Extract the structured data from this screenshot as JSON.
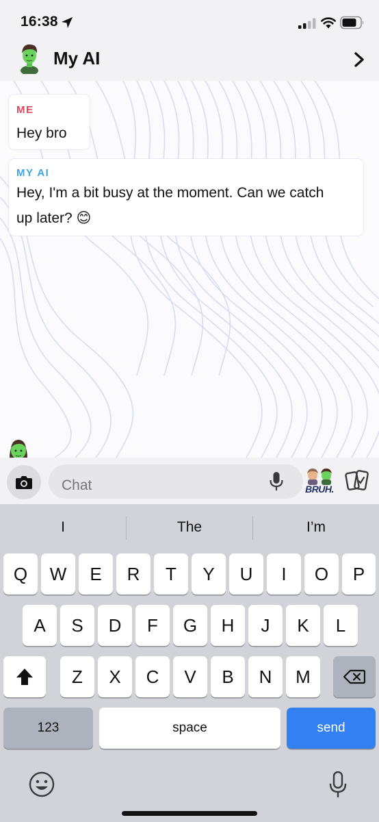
{
  "status_bar": {
    "time": "16:38",
    "icons": [
      "location-arrow-icon",
      "cellular-signal-icon",
      "wifi-icon",
      "battery-icon"
    ]
  },
  "header": {
    "title": "My AI",
    "avatar_icon": "bitmoji-avatar-icon",
    "right_icon": "chevron-right-icon"
  },
  "messages": [
    {
      "sender": "ME",
      "text": "Hey bro",
      "sender_color": "#e0475d"
    },
    {
      "sender": "MY AI",
      "lines": [
        "Hey, I'm a bit busy at the moment. Can we catch",
        "up later? 😊"
      ],
      "sender_color": "#3fa3e6"
    }
  ],
  "input_bar": {
    "placeholder": "Chat",
    "bitmoji_label": "BRUH.",
    "icons": [
      "camera-icon",
      "microphone-icon",
      "bitmoji-sticker-icon",
      "cards-icon"
    ]
  },
  "keyboard": {
    "suggestions": [
      "I",
      "The",
      "I’m"
    ],
    "row1": [
      "Q",
      "W",
      "E",
      "R",
      "T",
      "Y",
      "U",
      "I",
      "O",
      "P"
    ],
    "row2": [
      "A",
      "S",
      "D",
      "F",
      "G",
      "H",
      "J",
      "K",
      "L"
    ],
    "row3": [
      "Z",
      "X",
      "C",
      "V",
      "B",
      "N",
      "M"
    ],
    "numbers_key": "123",
    "space_key": "space",
    "send_key": "send",
    "accent_color": "#3380f2"
  }
}
